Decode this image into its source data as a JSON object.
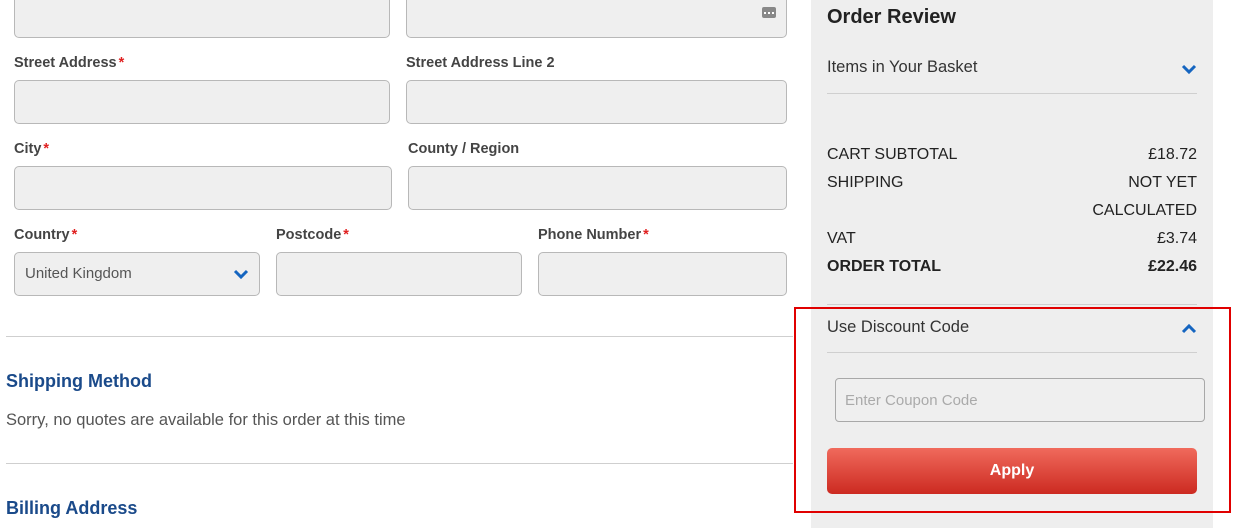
{
  "form": {
    "street_address_label": "Street Address",
    "street_address_line2_label": "Street Address Line 2",
    "city_label": "City",
    "county_label": "County / Region",
    "country_label": "Country",
    "country_value": "United Kingdom",
    "postcode_label": "Postcode",
    "phone_label": "Phone Number",
    "required_mark": "*"
  },
  "shipping": {
    "title": "Shipping Method",
    "message": "Sorry, no quotes are available for this order at this time"
  },
  "billing": {
    "title": "Billing Address"
  },
  "order_review": {
    "title": "Order Review",
    "items_label": "Items in Your Basket",
    "subtotal_label": "CART SUBTOTAL",
    "subtotal_value": "£18.72",
    "shipping_label": "SHIPPING",
    "shipping_value_line1": "NOT YET",
    "shipping_value_line2": "CALCULATED",
    "vat_label": "VAT",
    "vat_value": "£3.74",
    "total_label": "ORDER TOTAL",
    "total_value": "£22.46"
  },
  "discount": {
    "label": "Use Discount Code",
    "placeholder": "Enter Coupon Code",
    "apply_label": "Apply"
  },
  "colors": {
    "accent_blue": "#1a4a8a",
    "chevron_blue": "#1565c0",
    "apply_red": "#cc2a21",
    "highlight_red": "#e00000"
  }
}
